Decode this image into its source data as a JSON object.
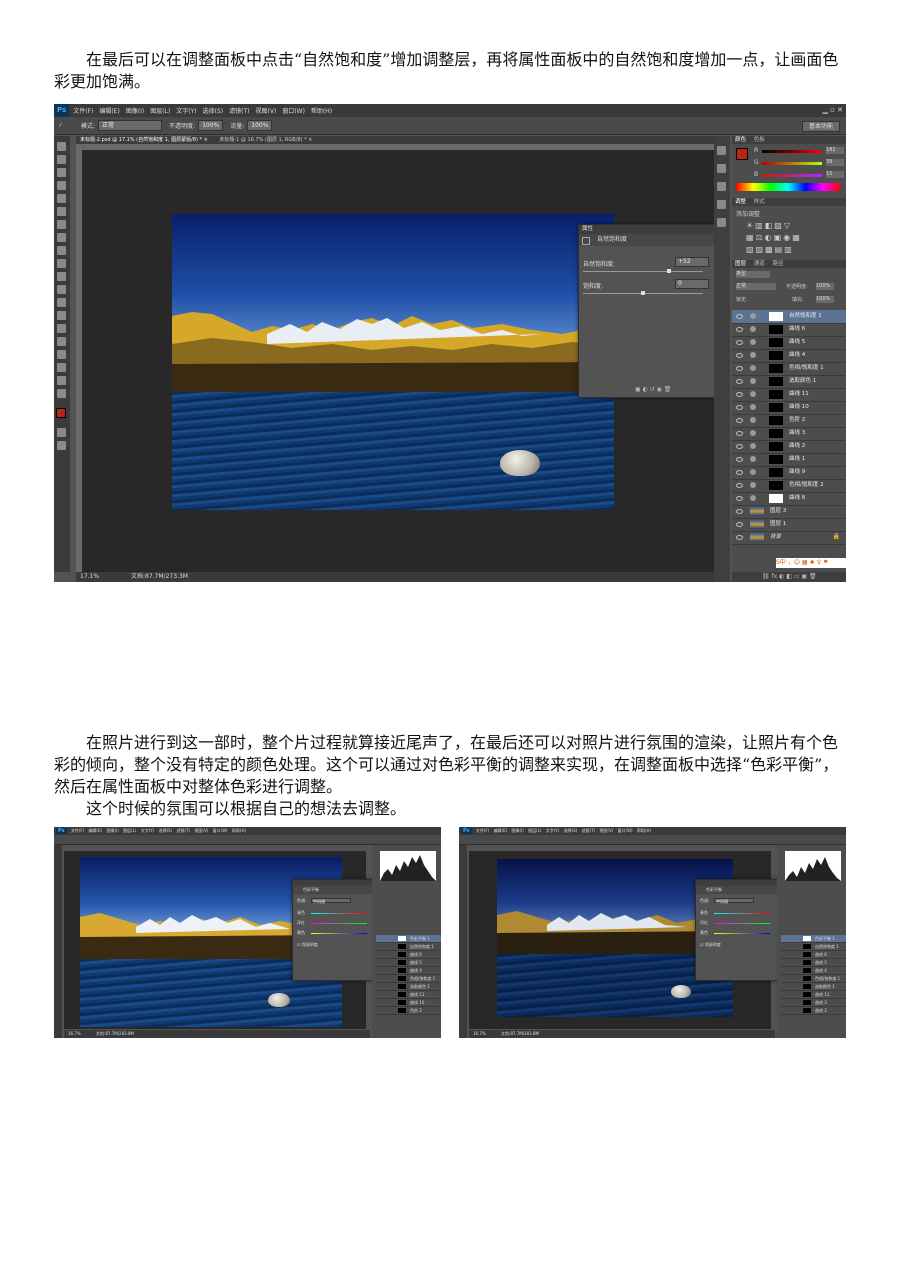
{
  "paragraph1": "在最后可以在调整面板中点击“自然饱和度”增加调整层，再将属性面板中的自然饱和度增加一点，让画面色彩更加饱满。",
  "paragraph2": "在照片进行到这一部时，整个片过程就算接近尾声了，在最后还可以对照片进行氛围的渲染，让照片有个色彩的倾向，整个没有特定的颜色处理。这个可以通过对色彩平衡的调整来实现，在调整面板中选择“色彩平衡”，然后在属性面板中对整体色彩进行调整。",
  "paragraph3": "这个时候的氛围可以根据自己的想法去调整。",
  "ps_main": {
    "app_logo": "Ps",
    "menu": [
      "文件(F)",
      "编辑(E)",
      "图像(I)",
      "图层(L)",
      "文字(Y)",
      "选择(S)",
      "滤镜(T)",
      "视图(V)",
      "窗口(W)",
      "帮助(H)"
    ],
    "options": {
      "style_label": "模式:",
      "style_value": "正常",
      "opacity_label": "不透明度:",
      "opacity_value": "100%",
      "flow_label": "流量:",
      "flow_value": "100%",
      "workspace": "基本功能"
    },
    "doc_tab": "未标题-2.psd @ 17.1% (自然饱和度 1, 图层蒙版/8) * ×",
    "doc_tab_inactive": "未标题-1 @ 16.7% (图层 1, RGB/8) * ×",
    "status_zoom": "17.1%",
    "status_doc": "文档:87.7M/273.3M",
    "color_panel": {
      "tab1": "颜色",
      "tab2": "色板",
      "r_label": "R",
      "g_label": "G",
      "b_label": "B",
      "r": "181",
      "g": "39",
      "b": "15"
    },
    "adjust_panel": {
      "tab1": "调整",
      "tab2": "样式",
      "title": "添加调整"
    },
    "properties": {
      "title": "属性",
      "header": "自然饱和度",
      "vibrance_label": "自然饱和度:",
      "vibrance_value": "+52",
      "saturation_label": "饱和度:",
      "saturation_value": "0"
    },
    "layers_panel": {
      "tabs": [
        "图层",
        "通道",
        "路径"
      ],
      "kind": "类型",
      "blend": "正常",
      "opacity_label": "不透明度:",
      "opacity_value": "100%",
      "lock_label": "锁定:",
      "fill_label": "填充:",
      "fill_value": "100%",
      "layers": [
        "自然饱和度 1",
        "曲线 6",
        "曲线 5",
        "曲线 4",
        "色相/饱和度 1",
        "选取颜色 1",
        "曲线 11",
        "曲线 10",
        "色阶 2",
        "曲线 3",
        "曲线 2",
        "曲线 1",
        "曲线 9",
        "色相/饱和度 2",
        "曲线 8",
        "图层 3",
        "图层 1",
        "背景"
      ]
    },
    "ime_bar": "S中·，☺ ▦ ♠ ♀ ⚑"
  },
  "ps_small": {
    "app_logo": "Ps",
    "menu": [
      "文件(F)",
      "编辑(E)",
      "图像(I)",
      "图层(L)",
      "文字(Y)",
      "选择(S)",
      "滤镜(T)",
      "视图(V)",
      "窗口(W)",
      "帮助(H)"
    ],
    "props_header": "色彩平衡",
    "tone_label": "色调:",
    "tone_value": "中间调",
    "rows": [
      {
        "left": "青色",
        "right": "红色"
      },
      {
        "left": "洋红",
        "right": "绿色"
      },
      {
        "left": "黄色",
        "right": "蓝色"
      }
    ],
    "preserve": "保留明度",
    "layers": [
      "色彩平衡 1",
      "自然饱和度 1",
      "曲线 6",
      "曲线 5",
      "曲线 4",
      "色相/饱和度 1",
      "选取颜色 1",
      "曲线 11",
      "曲线 10",
      "色阶 2",
      "曲线 3",
      "曲线 2"
    ],
    "status_zoom": "16.7%",
    "status_doc": "文档:87.7M/283.8M"
  },
  "colors": {
    "foreground": "#b5270f",
    "accent_blue": "#2f6fd6",
    "ps_dark": "#3a3a3a"
  }
}
